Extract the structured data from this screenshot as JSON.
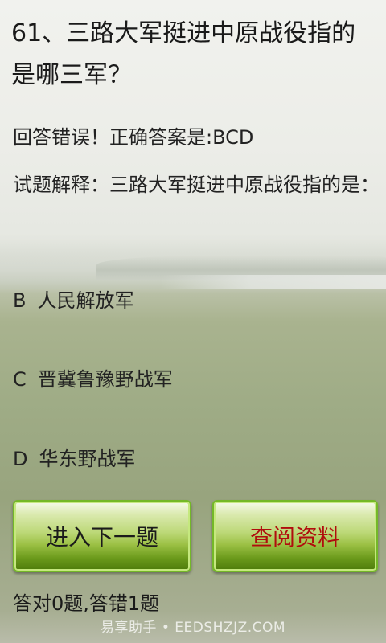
{
  "question": {
    "text": "61、三路大军挺进中原战役指的是哪三军？"
  },
  "result": {
    "text": "回答错误！正确答案是:BCD"
  },
  "explanation": {
    "text": "试题解释：三路大军挺进中原战役指的是："
  },
  "options": [
    {
      "letter": "B",
      "text": "人民解放军"
    },
    {
      "letter": "C",
      "text": "晋冀鲁豫野战军"
    },
    {
      "letter": "D",
      "text": "华东野战军"
    }
  ],
  "buttons": {
    "next_label": "进入下一题",
    "reference_label": "查阅资料"
  },
  "score": {
    "text": "答对0题,答错1题"
  },
  "watermark": {
    "text": "易享助手 • EEDSHZJZ.COM"
  },
  "colors": {
    "button_green": "#74b828",
    "reference_text_red": "#b00d0d"
  }
}
